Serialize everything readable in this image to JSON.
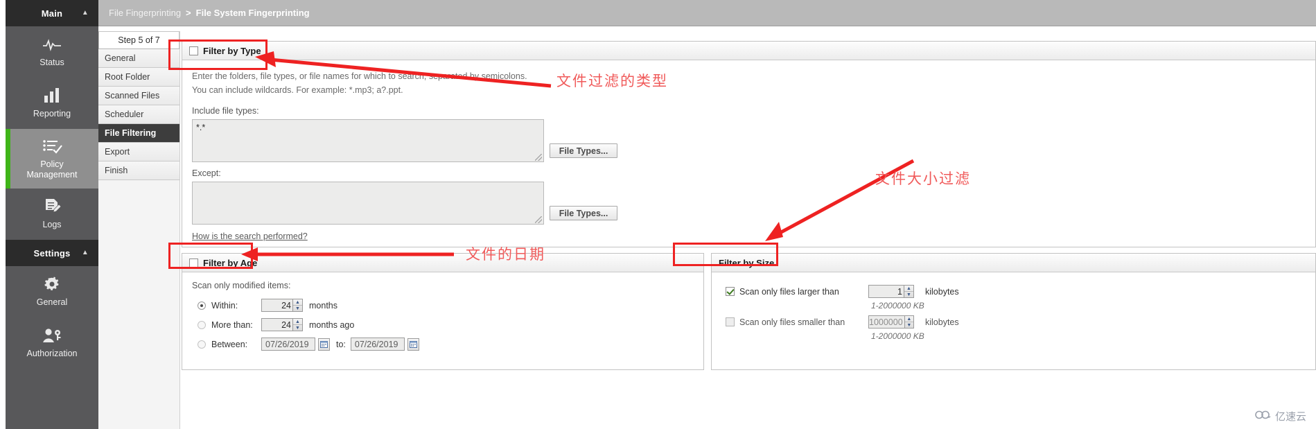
{
  "sidebar": {
    "groups": [
      {
        "header": "Main",
        "chevron": "chevron-up",
        "items": [
          {
            "label": "Status",
            "icon": "pulse-icon",
            "active": false
          },
          {
            "label": "Reporting",
            "icon": "bar-chart-icon",
            "active": false
          },
          {
            "label": "Policy\nManagement",
            "icon": "checklist-icon",
            "active": true
          },
          {
            "label": "Logs",
            "icon": "document-edit-icon",
            "active": false
          }
        ]
      },
      {
        "header": "Settings",
        "chevron": "chevron-up",
        "items": [
          {
            "label": "General",
            "icon": "gear-icon",
            "active": false
          },
          {
            "label": "Authorization",
            "icon": "user-key-icon",
            "active": false
          }
        ]
      }
    ]
  },
  "breadcrumb": {
    "root": "File Fingerprinting",
    "separator": ">",
    "current": "File System Fingerprinting"
  },
  "wizard": {
    "step_counter": "Step 5 of 7",
    "steps": [
      {
        "label": "General",
        "active": false
      },
      {
        "label": "Root Folder",
        "active": false
      },
      {
        "label": "Scanned Files",
        "active": false
      },
      {
        "label": "Scheduler",
        "active": false
      },
      {
        "label": "File Filtering",
        "active": true
      },
      {
        "label": "Export",
        "active": false
      },
      {
        "label": "Finish",
        "active": false
      }
    ]
  },
  "filter_by_type": {
    "title": "Filter by Type",
    "checked": false,
    "hint_line1": "Enter the folders, file types, or file names for which to search, separated by semicolons.",
    "hint_line2": "You can include wildcards. For example: *.mp3; a?.ppt.",
    "include_label": "Include file types:",
    "include_value": "*.*",
    "include_button": "File Types...",
    "except_label": "Except:",
    "except_value": "",
    "except_button": "File Types...",
    "help_link": "How is the search performed?"
  },
  "filter_by_age": {
    "title": "Filter by Age",
    "checked": false,
    "subtitle": "Scan only modified items:",
    "options": [
      {
        "label": "Within:",
        "selected": true,
        "value": "24",
        "suffix": "months"
      },
      {
        "label": "More than:",
        "selected": false,
        "value": "24",
        "suffix": "months ago"
      },
      {
        "label": "Between:",
        "selected": false,
        "date_from": "07/26/2019",
        "to_label": "to:",
        "date_to": "07/26/2019"
      }
    ]
  },
  "filter_by_size": {
    "title": "Filter by Size",
    "rows": [
      {
        "label": "Scan only files larger than",
        "checked": true,
        "value": "1",
        "unit": "kilobytes",
        "range": "1-2000000 KB"
      },
      {
        "label": "Scan only files smaller than",
        "checked": false,
        "value": "1000000",
        "unit": "kilobytes",
        "range": "1-2000000 KB"
      }
    ]
  },
  "annotations": {
    "accent_color": "#ee2222",
    "text_color": "#f05a5a",
    "callouts": [
      {
        "text": "文件过滤的类型",
        "points_to": "filter-by-type-header"
      },
      {
        "text": "文件大小过滤",
        "points_to": "filter-by-size-header"
      },
      {
        "text": "文件的日期",
        "points_to": "filter-by-age-header"
      }
    ]
  },
  "watermark": {
    "text": "亿速云",
    "icon": "cloud-icon"
  }
}
